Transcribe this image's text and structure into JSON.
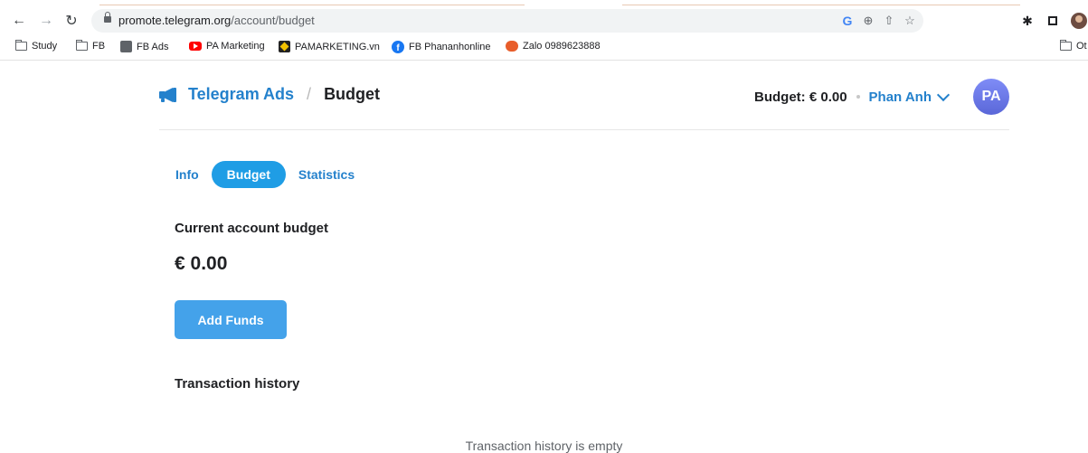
{
  "browser": {
    "url_host": "promote.telegram.org",
    "url_path": "/account/budget"
  },
  "bookmarks": [
    {
      "label": "Study",
      "icon": "folder-icon"
    },
    {
      "label": "FB",
      "icon": "folder-icon"
    },
    {
      "label": "FB Ads",
      "icon": "fb-ads-icon"
    },
    {
      "label": "PA Marketing",
      "icon": "youtube-icon"
    },
    {
      "label": "PAMARKETING.vn",
      "icon": "pamarketing-icon"
    },
    {
      "label": "FB Phananhonline",
      "icon": "facebook-icon"
    },
    {
      "label": "Zalo 0989623888",
      "icon": "zalo-icon"
    },
    {
      "label": "Ot",
      "icon": "folder-icon"
    }
  ],
  "header": {
    "brand": "Telegram Ads",
    "separator": "/",
    "crumb": "Budget",
    "budget_summary": "Budget: € 0.00",
    "user_name": "Phan Anh",
    "avatar_initials": "PA"
  },
  "tabs": [
    {
      "label": "Info",
      "active": false
    },
    {
      "label": "Budget",
      "active": true
    },
    {
      "label": "Statistics",
      "active": false
    }
  ],
  "budget": {
    "title": "Current account budget",
    "amount": "€ 0.00",
    "add_funds_label": "Add Funds"
  },
  "history": {
    "title": "Transaction history",
    "empty_text": "Transaction history is empty"
  },
  "colors": {
    "accent": "#2481cc",
    "active_tab": "#1f9de5",
    "button": "#44a2ea",
    "avatar": "#6b78ee"
  }
}
